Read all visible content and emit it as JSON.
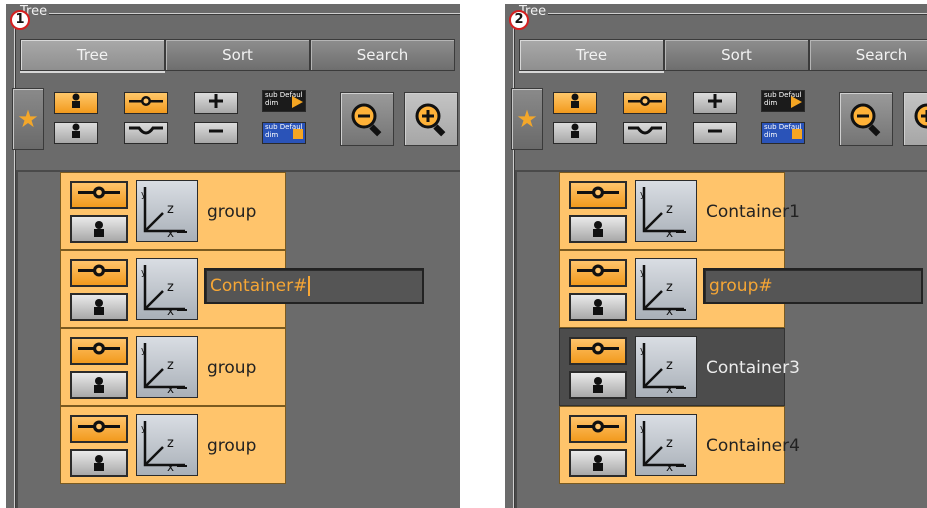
{
  "panels": [
    {
      "badge": "1",
      "title": "Tree",
      "tabs": [
        "Tree",
        "Sort",
        "Search"
      ],
      "toolbar": {
        "sub_top": "sub Defaul dim",
        "sub_bottom": "sub Defaul dim"
      },
      "nodes": [
        "group",
        "",
        "group",
        "group"
      ],
      "edit_value": "Container#"
    },
    {
      "badge": "2",
      "title": "Tree",
      "tabs": [
        "Tree",
        "Sort",
        "Search"
      ],
      "toolbar": {
        "sub_top": "sub Defaul dim",
        "sub_bottom": "sub Defaul dim"
      },
      "nodes": [
        "Container1",
        "",
        "Container3",
        "Container4"
      ],
      "edit_value": "group#"
    }
  ],
  "colors": {
    "node_orange": "#ffc46b",
    "node_selected": "#4c4c4c",
    "edit_text": "#f6a635",
    "badge_ring": "#d42020"
  },
  "icons": [
    "star-icon",
    "person-icon",
    "eye-icon",
    "plus-icon",
    "minus-icon",
    "curve-icon",
    "zoom-out-icon",
    "zoom-in-icon",
    "axis-xyz-icon"
  ]
}
